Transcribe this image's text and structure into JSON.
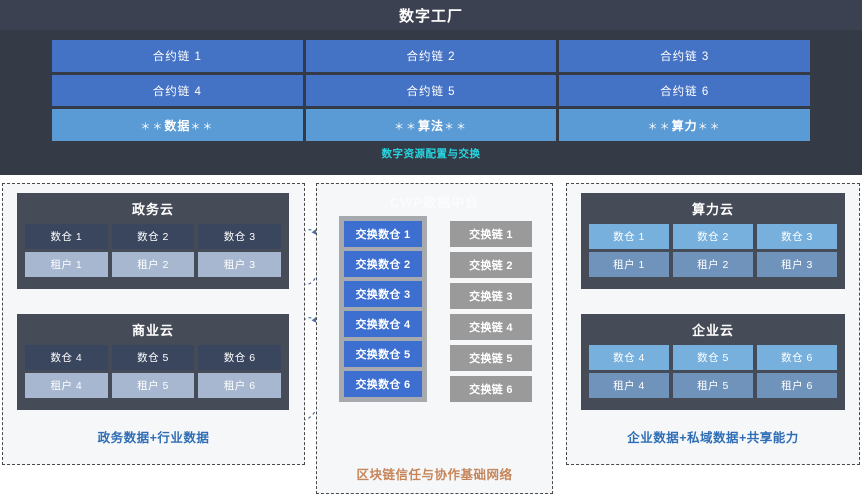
{
  "top": {
    "title": "数字工厂",
    "rows": [
      {
        "cells": [
          {
            "label": "合约链",
            "num": "1",
            "kind": "contract"
          },
          {
            "label": "合约链",
            "num": "2",
            "kind": "contract"
          },
          {
            "label": "合约链",
            "num": "3",
            "kind": "contract"
          }
        ]
      },
      {
        "cells": [
          {
            "label": "合约链",
            "num": "4",
            "kind": "contract"
          },
          {
            "label": "合约链",
            "num": "5",
            "kind": "contract"
          },
          {
            "label": "合约链",
            "num": "6",
            "kind": "contract"
          }
        ]
      },
      {
        "cells": [
          {
            "label": "数据",
            "num": "",
            "kind": "resource"
          },
          {
            "label": "算法",
            "num": "",
            "kind": "resource"
          },
          {
            "label": "算力",
            "num": "",
            "kind": "resource"
          }
        ]
      }
    ],
    "caption": "数字资源配置与交换",
    "star": "＊＊"
  },
  "left_panel": {
    "clouds": [
      {
        "title": "政务云",
        "warehouses": [
          "数仓 1",
          "数仓 2",
          "数仓 3"
        ],
        "tenants": [
          "租户 1",
          "租户 2",
          "租户 3"
        ]
      },
      {
        "title": "商业云",
        "warehouses": [
          "数仓 4",
          "数仓 5",
          "数仓 6"
        ],
        "tenants": [
          "租户 4",
          "租户 5",
          "租户 6"
        ]
      }
    ],
    "caption": "政务数据+行业数据"
  },
  "center_panel": {
    "title": "CWP数据中台",
    "exchange_warehouses": [
      "交换数仓 1",
      "交换数仓 2",
      "交换数仓 3",
      "交换数仓 4",
      "交换数仓 5",
      "交换数仓 6"
    ],
    "exchange_chains": [
      "交换链 1",
      "交换链 2",
      "交换链 3",
      "交换链 4",
      "交换链 5",
      "交换链 6"
    ],
    "caption": "区块链信任与协作基础网络"
  },
  "right_panel": {
    "clouds": [
      {
        "title": "算力云",
        "warehouses": [
          "数仓 1",
          "数仓 2",
          "数仓 3"
        ],
        "tenants": [
          "租户 1",
          "租户 2",
          "租户 3"
        ]
      },
      {
        "title": "企业云",
        "warehouses": [
          "数仓 4",
          "数仓 5",
          "数仓 6"
        ],
        "tenants": [
          "租户 4",
          "租户 5",
          "租户 6"
        ]
      }
    ],
    "caption": "企业数据+私域数据+共享能力"
  },
  "colors": {
    "dark_bg": "#343a46",
    "title_bar": "#3b4150",
    "contract_blue": "#4472c4",
    "resource_blue": "#5b9bd5",
    "caption_cyan": "#27d4e0",
    "cloud_box": "#454b57",
    "caption_blue": "#2f6eb5",
    "caption_orange": "#c6855a",
    "exchange_dw": "#3d6fd0",
    "exchange_chain": "#9a9a9a"
  }
}
